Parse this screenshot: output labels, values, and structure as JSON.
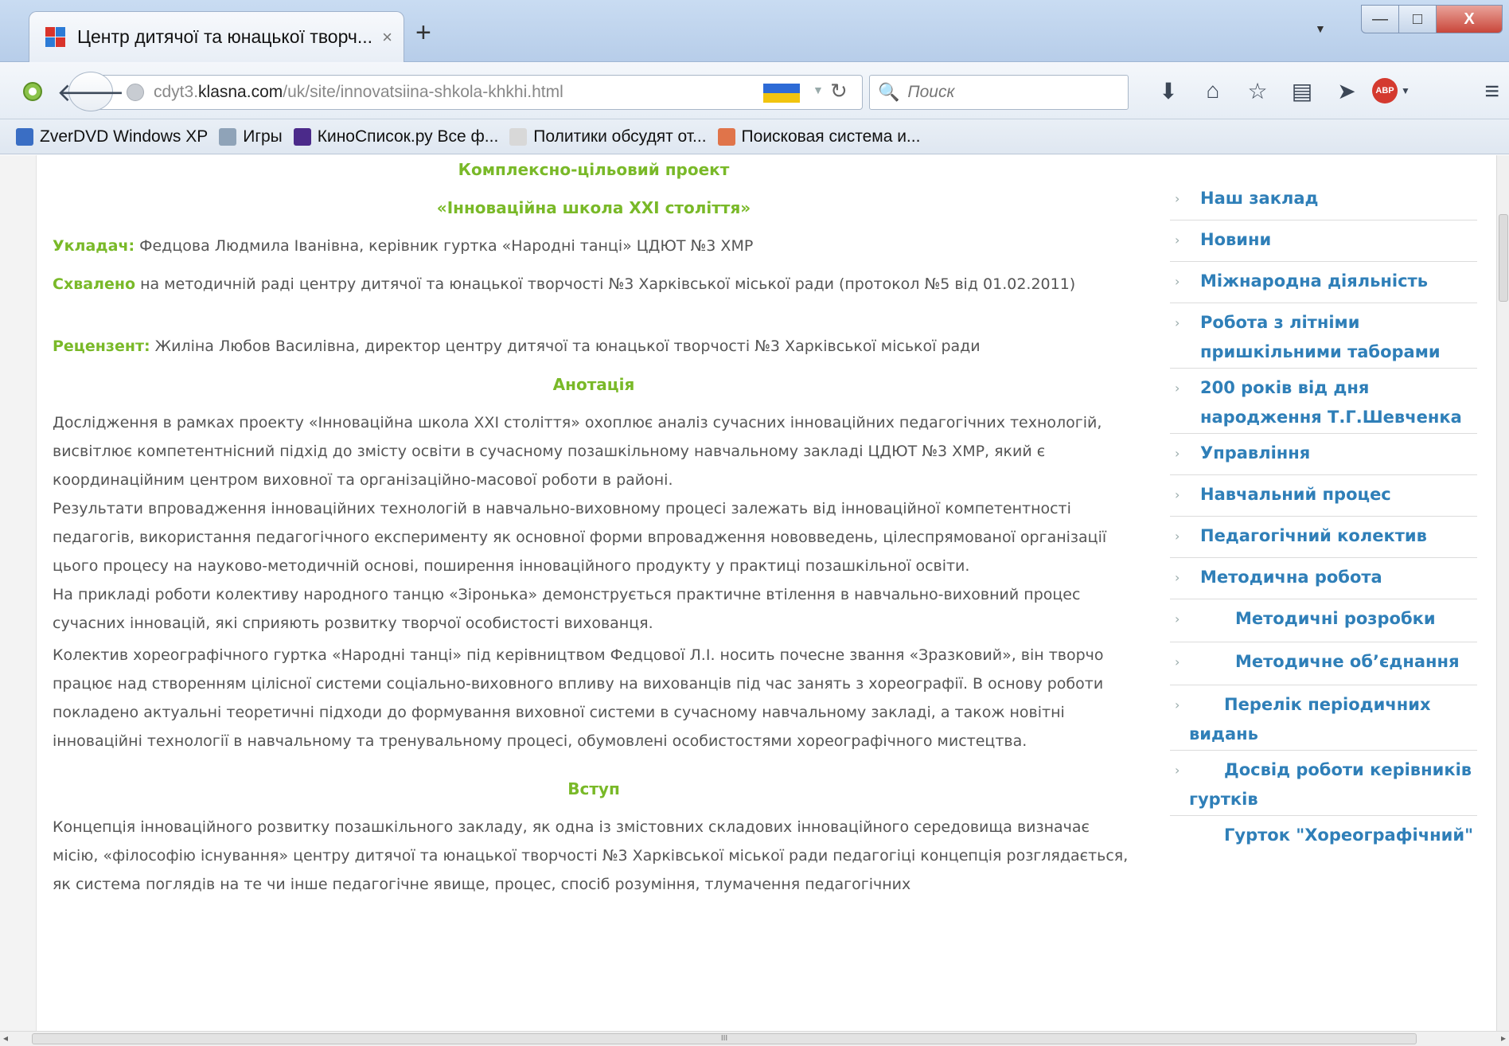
{
  "window": {
    "tab_title": "Центр дитячої та юнацької творч...",
    "tab_close": "×",
    "new_tab": "+",
    "controls": {
      "minimize": "—",
      "maximize": "□",
      "close": "X"
    }
  },
  "navbar": {
    "url_prefix": "cdyt3.",
    "url_domain": "klasna.com",
    "url_path": "/uk/site/innovatsiina-shkola-khkhi.html",
    "search_placeholder": "Поиск",
    "abp_label": "ABP"
  },
  "bookmarks": [
    {
      "label": "ZverDVD Windows XP",
      "icon_color": "#3a6ec4"
    },
    {
      "label": "Игры",
      "icon_color": "#8fa3b8"
    },
    {
      "label": "КиноСписок.ру Все ф...",
      "icon_color": "#4b2a8a"
    },
    {
      "label": "Политики обсудят от...",
      "icon_color": "#d8d8d8"
    },
    {
      "label": "Поисковая система и...",
      "icon_color": "#e0744a"
    }
  ],
  "article": {
    "title": "Комплексно-цільовий проект",
    "subtitle": "«Інноваційна школа XXI століття»",
    "compiler_label": "Укладач:",
    "compiler_text": " Федцова Людмила Іванівна, керівник гуртка «Народні танці» ЦДЮТ №3 ХМР",
    "approved_label": "Схвалено",
    "approved_text": " на методичній раді центру дитячої та юнацької творчості №3 Харківської міської ради (протокол №5 від 01.02.2011)",
    "reviewer_label": "Рецензент:",
    "reviewer_text": " Жиліна Любов Василівна, директор центру дитячої та юнацької творчості №3 Харківської міської ради",
    "annotation_heading": "Анотація",
    "para1": "Дослідження в рамках проекту «Інноваційна школа XXI століття» охоплює аналіз сучасних інноваційних педагогічних технологій, висвітлює компетентнісний підхід до змісту освіти в сучасному позашкільному навчальному закладі ЦДЮТ №3 ХМР, який є координаційним центром виховної та організаційно-масової роботи в районі.",
    "para2": "Результати впровадження інноваційних технологій в навчально-виховному процесі залежать від інноваційної компетентності педагогів, використання педагогічного експерименту як основної форми впровадження нововведень, цілеспрямованої організації цього процесу на науково-методичній основі, поширення  інноваційного продукту у практиці позашкільної освіти.",
    "para3": "На прикладі роботи колективу народного танцю «Зіронька» демонструється практичне втілення в навчально-виховний процес сучасних інновацій, які сприяють розвитку творчої особистості вихованця.",
    "para4": "Колектив хореографічного гуртка «Народні танці» під керівництвом Федцової Л.І. носить почесне звання «Зразковий», він творчо працює над створенням цілісної системи соціально-виховного впливу на вихованців під час занять з хореографії. В основу роботи покладено актуальні теоретичні підходи до формування виховної системи в сучасному навчальному закладі, а також новітні інноваційні технології в навчальному та тренувальному процесі, обумовлені особистостями хореографічного мистецтва.",
    "intro_heading": "Вступ",
    "para5": "Концепція інноваційного розвитку позашкільного закладу, як одна із змістовних складових інноваційного середовища визначає місію, «філософію існування» центру дитячої та юнацької творчості №3 Харківської міської ради педагогіці концепція розглядається, як система поглядів на те чи інше педагогічне явище, процес, спосіб розуміння, тлумачення педагогічних"
  },
  "sidebar": [
    {
      "label": "Наш заклад"
    },
    {
      "label": "Новини"
    },
    {
      "label": "Міжнародна діяльність"
    },
    {
      "label": "Робота з літніми пришкільними таборами"
    },
    {
      "label": "200 років від дня народження Т.Г.Шевченка"
    },
    {
      "label": "Управління"
    },
    {
      "label": "Навчальний процес"
    },
    {
      "label": "Педагогічний колектив"
    },
    {
      "label": "Методична робота"
    },
    {
      "label": "Методичні розробки"
    },
    {
      "label": "Методичне об’єднання"
    },
    {
      "label": "Перелік періодичних видань"
    },
    {
      "label": "Досвід роботи керівників гуртків"
    },
    {
      "label": "Гурток \"Хореографічний\""
    }
  ],
  "icons": {
    "chevron": "›",
    "scroll_grip": "III",
    "scroll_left": "◂",
    "scroll_right": "▸"
  }
}
